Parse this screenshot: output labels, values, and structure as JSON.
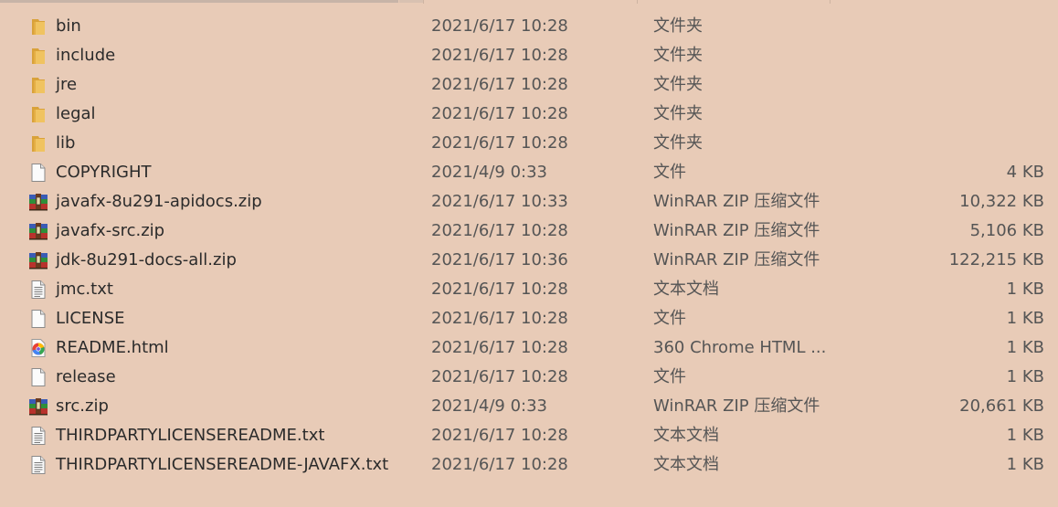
{
  "files": [
    {
      "name": "bin",
      "date": "2021/6/17 10:28",
      "type": "文件夹",
      "size": "",
      "icon": "folder-icon"
    },
    {
      "name": "include",
      "date": "2021/6/17 10:28",
      "type": "文件夹",
      "size": "",
      "icon": "folder-icon"
    },
    {
      "name": "jre",
      "date": "2021/6/17 10:28",
      "type": "文件夹",
      "size": "",
      "icon": "folder-icon"
    },
    {
      "name": "legal",
      "date": "2021/6/17 10:28",
      "type": "文件夹",
      "size": "",
      "icon": "folder-icon"
    },
    {
      "name": "lib",
      "date": "2021/6/17 10:28",
      "type": "文件夹",
      "size": "",
      "icon": "folder-icon"
    },
    {
      "name": "COPYRIGHT",
      "date": "2021/4/9 0:33",
      "type": "文件",
      "size": "4 KB",
      "icon": "blank-file-icon"
    },
    {
      "name": "javafx-8u291-apidocs.zip",
      "date": "2021/6/17 10:33",
      "type": "WinRAR ZIP 压缩文件",
      "size": "10,322 KB",
      "icon": "winrar-archive-icon"
    },
    {
      "name": "javafx-src.zip",
      "date": "2021/6/17 10:28",
      "type": "WinRAR ZIP 压缩文件",
      "size": "5,106 KB",
      "icon": "winrar-archive-icon"
    },
    {
      "name": "jdk-8u291-docs-all.zip",
      "date": "2021/6/17 10:36",
      "type": "WinRAR ZIP 压缩文件",
      "size": "122,215 KB",
      "icon": "winrar-archive-icon"
    },
    {
      "name": "jmc.txt",
      "date": "2021/6/17 10:28",
      "type": "文本文档",
      "size": "1 KB",
      "icon": "text-file-icon"
    },
    {
      "name": "LICENSE",
      "date": "2021/6/17 10:28",
      "type": "文件",
      "size": "1 KB",
      "icon": "blank-file-icon"
    },
    {
      "name": "README.html",
      "date": "2021/6/17 10:28",
      "type": "360 Chrome HTML ...",
      "size": "1 KB",
      "icon": "browser-html-icon"
    },
    {
      "name": "release",
      "date": "2021/6/17 10:28",
      "type": "文件",
      "size": "1 KB",
      "icon": "blank-file-icon"
    },
    {
      "name": "src.zip",
      "date": "2021/4/9 0:33",
      "type": "WinRAR ZIP 压缩文件",
      "size": "20,661 KB",
      "icon": "winrar-archive-icon"
    },
    {
      "name": "THIRDPARTYLICENSEREADME.txt",
      "date": "2021/6/17 10:28",
      "type": "文本文档",
      "size": "1 KB",
      "icon": "text-file-icon"
    },
    {
      "name": "THIRDPARTYLICENSEREADME-JAVAFX.txt",
      "date": "2021/6/17 10:28",
      "type": "文本文档",
      "size": "1 KB",
      "icon": "text-file-icon"
    }
  ],
  "colors": {
    "background": "#e8cbb7",
    "folder": "#e8b54a",
    "text": "#2b2b2b"
  }
}
